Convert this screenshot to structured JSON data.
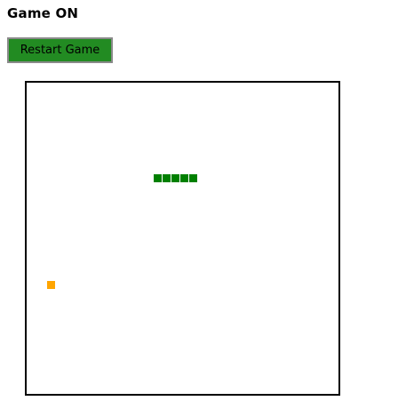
{
  "status": {
    "text": "Game ON"
  },
  "controls": {
    "restart_label": "Restart Game"
  },
  "board": {
    "grid_columns": 35,
    "grid_rows": 35,
    "border_color": "#000000",
    "background_color": "#ffffff"
  },
  "snake": {
    "color": "#008000",
    "segments": [
      {
        "col": 14,
        "row": 10
      },
      {
        "col": 15,
        "row": 10
      },
      {
        "col": 16,
        "row": 10
      },
      {
        "col": 17,
        "row": 10
      },
      {
        "col": 18,
        "row": 10
      }
    ]
  },
  "food": {
    "color": "#ffa500",
    "col": 2,
    "row": 22
  }
}
